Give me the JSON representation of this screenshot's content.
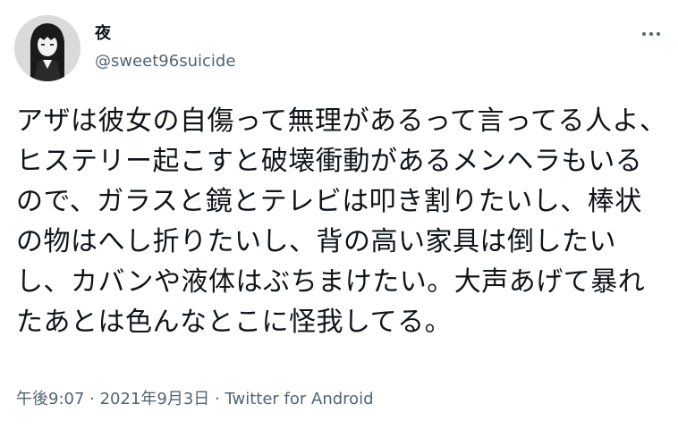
{
  "tweet": {
    "display_name": "夜",
    "handle": "@sweet96suicide",
    "text": "アザは彼女の自傷って無理があるって言ってる人よ、ヒステリー起こすと破壊衝動があるメンヘラもいるので、ガラスと鏡とテレビは叩き割りたいし、棒状の物はへし折りたいし、背の高い家具は倒したいし、カバンや液体はぶちまけたい。大声あげて暴れたあとは色んなとこに怪我してる。",
    "time": "午後9:07",
    "separator": " · ",
    "date": "2021年9月3日",
    "source": "Twitter for Android",
    "avatar_icon": "avatar-portrait-icon",
    "more_icon": "more-options-icon"
  },
  "colors": {
    "text_primary": "#0f1419",
    "text_secondary": "#536471",
    "background": "#ffffff"
  }
}
